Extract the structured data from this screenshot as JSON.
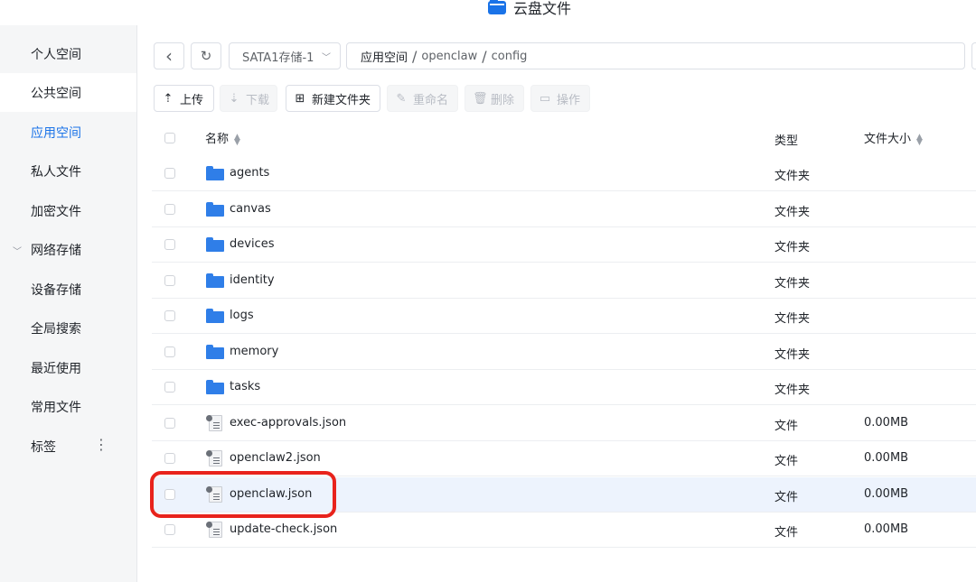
{
  "window": {
    "title": "云盘文件",
    "app_icon": "folder-icon"
  },
  "sidebar": {
    "items": [
      {
        "label": "个人空间"
      },
      {
        "label": "公共空间"
      },
      {
        "label": "应用空间"
      },
      {
        "label": "私人文件"
      },
      {
        "label": "加密文件"
      },
      {
        "label": "网络存储"
      },
      {
        "label": "设备存储"
      },
      {
        "label": "全局搜索"
      },
      {
        "label": "最近使用"
      },
      {
        "label": "常用文件"
      },
      {
        "label": "标签"
      }
    ],
    "selected_index": 2,
    "more_glyph": "⋮"
  },
  "nav": {
    "back_glyph": "‹",
    "refresh_glyph": "↻",
    "drive": "SATA1存储-1",
    "path": {
      "root": "应用空间",
      "parts": [
        "openclaw",
        "config"
      ]
    }
  },
  "toolbar": {
    "upload": "上传",
    "download": "下载",
    "new_folder": "新建文件夹",
    "rename": "重命名",
    "delete": "删除",
    "operate": "操作"
  },
  "table": {
    "headers": {
      "name": "名称",
      "type": "类型",
      "size": "文件大小"
    },
    "rows": [
      {
        "name": "agents",
        "type": "文件夹",
        "size": "",
        "kind": "folder"
      },
      {
        "name": "canvas",
        "type": "文件夹",
        "size": "",
        "kind": "folder"
      },
      {
        "name": "devices",
        "type": "文件夹",
        "size": "",
        "kind": "folder"
      },
      {
        "name": "identity",
        "type": "文件夹",
        "size": "",
        "kind": "folder"
      },
      {
        "name": "logs",
        "type": "文件夹",
        "size": "",
        "kind": "folder"
      },
      {
        "name": "memory",
        "type": "文件夹",
        "size": "",
        "kind": "folder"
      },
      {
        "name": "tasks",
        "type": "文件夹",
        "size": "",
        "kind": "folder"
      },
      {
        "name": "exec-approvals.json",
        "type": "文件",
        "size": "0.00MB",
        "kind": "file"
      },
      {
        "name": "openclaw2.json",
        "type": "文件",
        "size": "0.00MB",
        "kind": "file"
      },
      {
        "name": "openclaw.json",
        "type": "文件",
        "size": "0.00MB",
        "kind": "file"
      },
      {
        "name": "update-check.json",
        "type": "文件",
        "size": "0.00MB",
        "kind": "file"
      }
    ],
    "highlighted_row": "openclaw.json"
  },
  "colors": {
    "accent": "#1a73e8",
    "folder": "#2f7ee8",
    "annotation": "#e8231c",
    "row_highlight": "#edf3fd"
  }
}
